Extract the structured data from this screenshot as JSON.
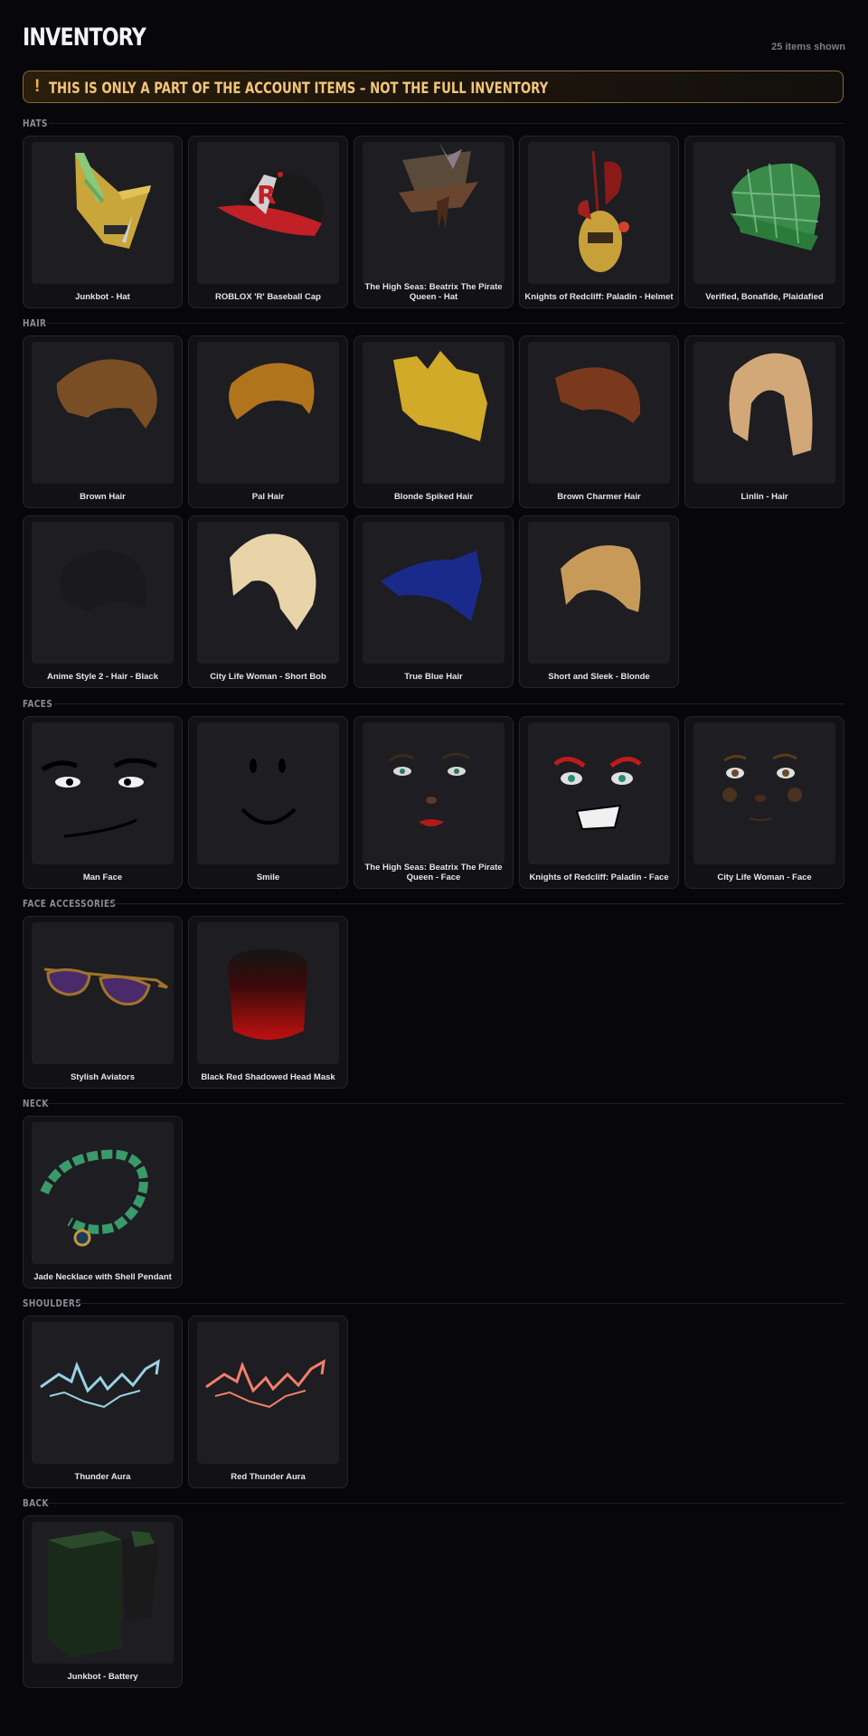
{
  "header": {
    "title": "INVENTORY",
    "count": "25 items shown"
  },
  "banner": {
    "icon": "exclamation-icon",
    "text": "THIS IS ONLY A PART OF THE ACCOUNT ITEMS – NOT THE FULL INVENTORY",
    "accent": "#f0b348"
  },
  "sections": {
    "hats": {
      "title": "HATS",
      "items": [
        {
          "name": "Junkbot - Hat",
          "icon": "junkbot-hat-image"
        },
        {
          "name": "ROBLOX 'R' Baseball Cap",
          "icon": "baseball-cap-image"
        },
        {
          "name": "The High Seas: Beatrix The Pirate Queen - Hat",
          "icon": "pirate-hat-image"
        },
        {
          "name": "Knights of Redcliff: Paladin - Helmet",
          "icon": "paladin-helmet-image"
        },
        {
          "name": "Verified, Bonafide, Plaidafied",
          "icon": "plaid-cap-image"
        }
      ]
    },
    "hair": {
      "title": "HAIR",
      "items": [
        {
          "name": "Brown Hair",
          "icon": "brown-hair-image"
        },
        {
          "name": "Pal Hair",
          "icon": "pal-hair-image"
        },
        {
          "name": "Blonde Spiked Hair",
          "icon": "blonde-spiked-hair-image"
        },
        {
          "name": "Brown Charmer Hair",
          "icon": "brown-charmer-hair-image"
        },
        {
          "name": "Linlin - Hair",
          "icon": "linlin-hair-image"
        },
        {
          "name": "Anime Style 2 - Hair - Black",
          "icon": "anime-hair-image"
        },
        {
          "name": "City Life Woman - Short Bob",
          "icon": "short-bob-image"
        },
        {
          "name": "True Blue Hair",
          "icon": "true-blue-hair-image"
        },
        {
          "name": "Short and Sleek - Blonde",
          "icon": "short-sleek-hair-image"
        }
      ]
    },
    "faces": {
      "title": "FACES",
      "items": [
        {
          "name": "Man Face",
          "icon": "man-face-image"
        },
        {
          "name": "Smile",
          "icon": "smile-face-image"
        },
        {
          "name": "The High Seas: Beatrix The Pirate Queen - Face",
          "icon": "pirate-queen-face-image"
        },
        {
          "name": "Knights of Redcliff: Paladin - Face",
          "icon": "paladin-face-image"
        },
        {
          "name": "City Life Woman - Face",
          "icon": "city-woman-face-image"
        }
      ]
    },
    "face_accessories": {
      "title": "FACE ACCESSORIES",
      "items": [
        {
          "name": "Stylish Aviators",
          "icon": "aviators-image"
        },
        {
          "name": "Black Red Shadowed Head Mask",
          "icon": "head-mask-image"
        }
      ]
    },
    "neck": {
      "title": "NECK",
      "items": [
        {
          "name": "Jade Necklace with Shell Pendant",
          "icon": "jade-necklace-image"
        }
      ]
    },
    "shoulders": {
      "title": "SHOULDERS",
      "items": [
        {
          "name": "Thunder Aura",
          "icon": "thunder-aura-image"
        },
        {
          "name": "Red Thunder Aura",
          "icon": "red-thunder-aura-image"
        }
      ]
    },
    "back": {
      "title": "BACK",
      "items": [
        {
          "name": "Junkbot - Battery",
          "icon": "junkbot-battery-image"
        }
      ]
    }
  }
}
